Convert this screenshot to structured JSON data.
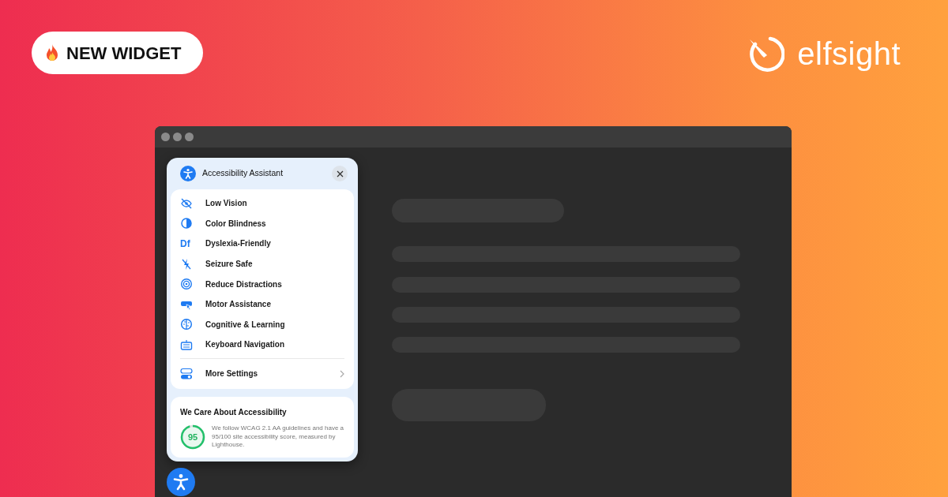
{
  "badge": {
    "label": "NEW WIDGET"
  },
  "logo": {
    "text": "elfsight"
  },
  "widget": {
    "title": "Accessibility Assistant",
    "items": [
      {
        "label": "Low Vision"
      },
      {
        "label": "Color Blindness"
      },
      {
        "label": "Dyslexia-Friendly",
        "icon_text": "Df"
      },
      {
        "label": "Seizure Safe"
      },
      {
        "label": "Reduce Distractions"
      },
      {
        "label": "Motor Assistance"
      },
      {
        "label": "Cognitive & Learning"
      },
      {
        "label": "Keyboard Navigation"
      }
    ],
    "more": {
      "label": "More Settings"
    },
    "info": {
      "title": "We Care About Accessibility",
      "score": "95",
      "level": 0.95,
      "text": "We follow WCAG 2.1 AA guidelines and have a 95/100 site accessibility score, measured by Lighthouse."
    }
  }
}
